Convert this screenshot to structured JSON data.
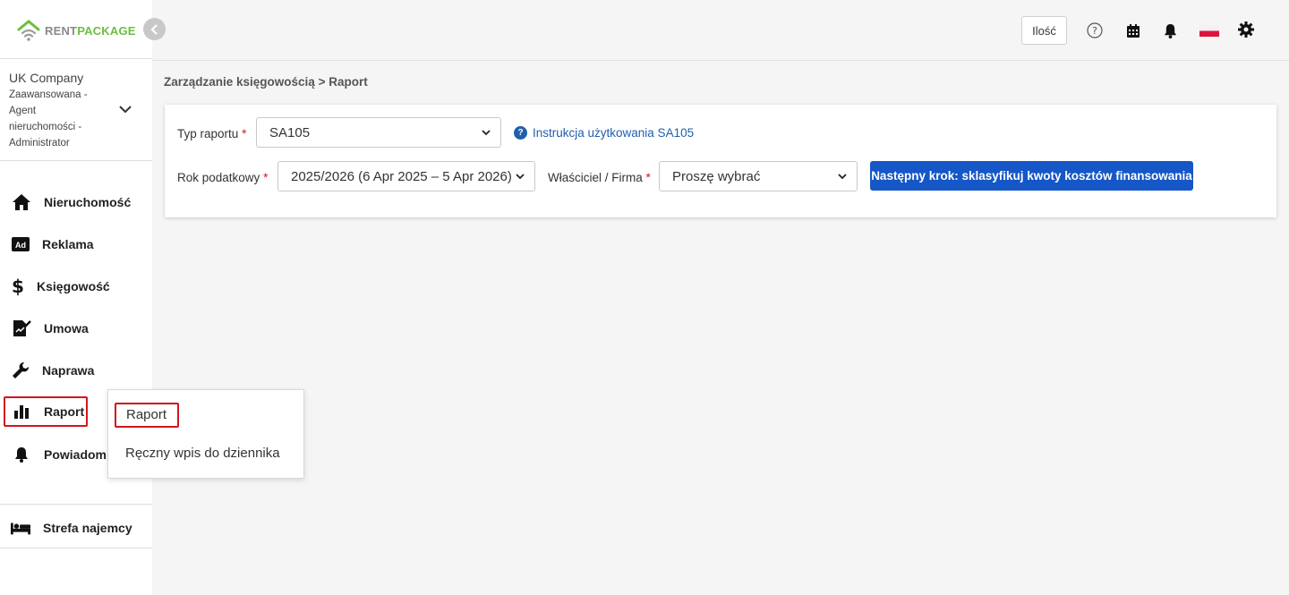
{
  "logo": {
    "rent": "RENT",
    "package": "PACKAGE"
  },
  "company": {
    "name": "UK Company",
    "role_lines": [
      "Zaawansowana -",
      "Agent",
      "nieruchomości -",
      "Administrator"
    ]
  },
  "sidebar": {
    "items": [
      {
        "label": "Nieruchomość",
        "icon": "home-icon"
      },
      {
        "label": "Reklama",
        "icon": "ad-icon"
      },
      {
        "label": "Księgowość",
        "icon": "dollar-icon"
      },
      {
        "label": "Umowa",
        "icon": "contract-icon"
      },
      {
        "label": "Naprawa",
        "icon": "wrench-icon"
      },
      {
        "label": "Raport",
        "icon": "bar-chart-icon",
        "active": true
      },
      {
        "label": "Powiadomi",
        "icon": "bell-icon"
      }
    ],
    "tenant_zone": {
      "label": "Strefa najemcy",
      "icon": "bed-icon"
    }
  },
  "topbar": {
    "ilosc_label": "Ilość",
    "icons": [
      "help-icon",
      "calendar-icon",
      "bell-icon",
      "poland-flag-icon",
      "gear-icon"
    ]
  },
  "breadcrumb": "Zarządzanie księgowością > Raport",
  "form": {
    "report_type_label": "Typ raportu",
    "report_type_value": "SA105",
    "help_link": "Instrukcja użytkowania SA105",
    "tax_year_label": "Rok podatkowy",
    "tax_year_value": "2025/2026 (6 Apr 2025 – 5 Apr 2026)",
    "owner_label": "Właściciel / Firma",
    "owner_value": "Proszę wybrać",
    "required_mark": "*",
    "next_button": "Następny krok: sklasyfikuj kwoty kosztów finansowania"
  },
  "popup_menu": {
    "items": [
      "Raport",
      "Ręczny wpis do dziennika"
    ]
  },
  "colors": {
    "accent_blue": "#1557c6",
    "link_blue": "#1f5fae",
    "required_red": "#d0161d",
    "logo_green": "#6cbf3f"
  }
}
